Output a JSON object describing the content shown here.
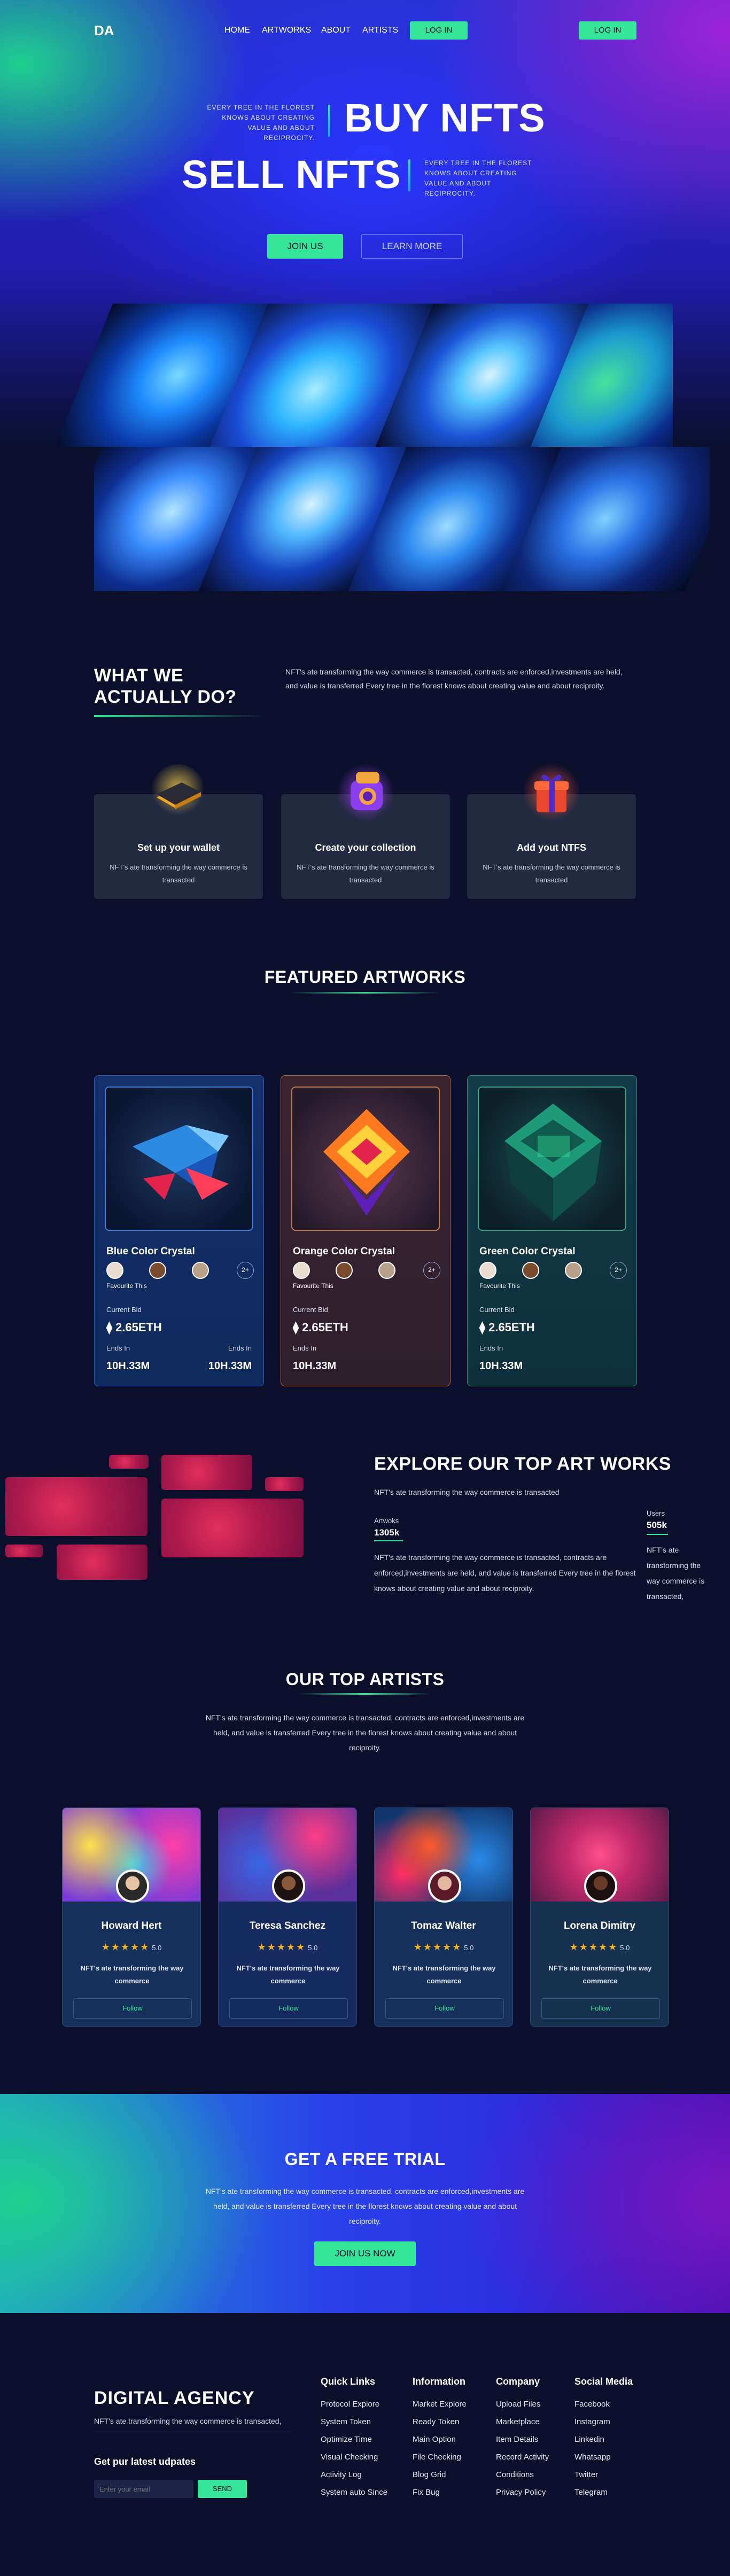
{
  "nav": {
    "logo": "DA",
    "links": [
      "HOME",
      "ARTWORKS",
      "ABOUT",
      "ARTISTS"
    ],
    "login": "LOG IN",
    "login_right": "LOG IN"
  },
  "hero": {
    "small_1": "EVERY TREE IN THE FLOREST KNOWS ABOUT CREATING VALUE AND ABOUT RECIPROCITY.",
    "big_1": "BUY NFTS",
    "big_2": "SELL NFTS",
    "small_2": "EVERY TREE IN THE FLOREST KNOWS ABOUT CREATING VALUE AND ABOUT RECIPROCITY.",
    "join": "JOIN US",
    "learn": "LEARN MORE"
  },
  "what": {
    "title_1": "WHAT WE",
    "title_2": "ACTUALLY DO?",
    "desc": "NFT's ate transforming the way commerce is transacted, contracts are enforced,investments are held, and value is transferred Every tree in the florest knows about creating value and about reciproity.",
    "cards": [
      {
        "title": "Set up your wallet",
        "desc": "NFT's ate transforming the way commerce is transacted",
        "icon": "wallet-icon"
      },
      {
        "title": "Create your collection",
        "desc": "NFT's ate transforming the way commerce is transacted",
        "icon": "camera-icon"
      },
      {
        "title": "Add yout NTFS",
        "desc": "NFT's ate transforming the way commerce is transacted",
        "icon": "gift-icon"
      }
    ]
  },
  "featured": {
    "title": "FEATURED ARTWORKS",
    "cards": [
      {
        "name": "Blue Color Crystal",
        "fav": "Favourite This",
        "plus": "2+",
        "bid_label": "Current Bid",
        "eth": "2.65ETH",
        "ends_label": "Ends In",
        "ends": "10H.33M"
      },
      {
        "name": "Orange Color Crystal",
        "fav": "Favourite This",
        "plus": "2+",
        "bid_label": "Current Bid",
        "eth": "2.65ETH",
        "ends_label": "Ends In",
        "ends": "10H.33M"
      },
      {
        "name": "Green Color Crystal",
        "fav": "Favourite This",
        "plus": "2+",
        "bid_label": "Current Bid",
        "eth": "2.65ETH",
        "ends_label": "Ends In",
        "ends": "10H.33M"
      }
    ]
  },
  "explore": {
    "title": "EXPLORE OUR TOP ART WORKS",
    "sub": "NFT's ate transforming the way commerce is transacted",
    "artworks_label": "Artwoks",
    "artworks_value": "1305k",
    "users_label": "Users",
    "users_value": "505k",
    "desc": "NFT's ate transforming the way commerce is transacted, contracts are enforced,investments are held, and value is transferred Every tree in the florest knows about creating value and about reciproity.",
    "side_desc": "NFT's ate transforming the way commerce is transacted,"
  },
  "artists": {
    "title": "OUR TOP ARTISTS",
    "desc": "NFT's ate transforming the way commerce is transacted, contracts are enforced,investments are held, and value is transferred Every tree in the florest knows about creating value and about reciproity.",
    "cards": [
      {
        "name": "Howard Hert",
        "rating": "5.0",
        "desc": "NFT's ate transforming the way commerce",
        "follow": "Follow"
      },
      {
        "name": "Teresa Sanchez",
        "rating": "5.0",
        "desc": "NFT's ate transforming the way commerce",
        "follow": "Follow"
      },
      {
        "name": "Tomaz Walter",
        "rating": "5.0",
        "desc": "NFT's ate transforming the way commerce",
        "follow": "Follow"
      },
      {
        "name": "Lorena Dimitry",
        "rating": "5.0",
        "desc": "NFT's ate transforming the way commerce",
        "follow": "Follow"
      }
    ]
  },
  "trial": {
    "title": "GET A FREE TRIAL",
    "desc": "NFT's ate transforming the way commerce is transacted, contracts are enforced,investments are held, and value is transferred Every tree in the florest knows about creating value and about reciproity.",
    "button": "JOIN US NOW"
  },
  "footer": {
    "brand": "DIGITAL AGENCY",
    "brand_desc": "NFT's ate transforming the way commerce is transacted,",
    "news_title": "Get pur latest udpates",
    "email_placeholder": "Enter your email",
    "send": "SEND",
    "columns": [
      {
        "title": "Quick Links",
        "items": [
          "Protocol Explore",
          "System Token",
          "Optimize Time",
          "Visual Checking",
          "Activity Log",
          "System auto Since"
        ]
      },
      {
        "title": "Information",
        "items": [
          "Market Explore",
          "Ready Token",
          "Main Option",
          "File Checking",
          "Blog Grid",
          "Fix Bug"
        ]
      },
      {
        "title": "Company",
        "items": [
          "Upload Files",
          "Marketplace",
          "Item Details",
          "Record Activity",
          "Conditions",
          "Privacy Policy"
        ]
      },
      {
        "title": "Social Media",
        "items": [
          "Facebook",
          "Instagram",
          "Linkedin",
          "Whatsapp",
          "Twitter",
          "Telegram"
        ]
      }
    ]
  }
}
